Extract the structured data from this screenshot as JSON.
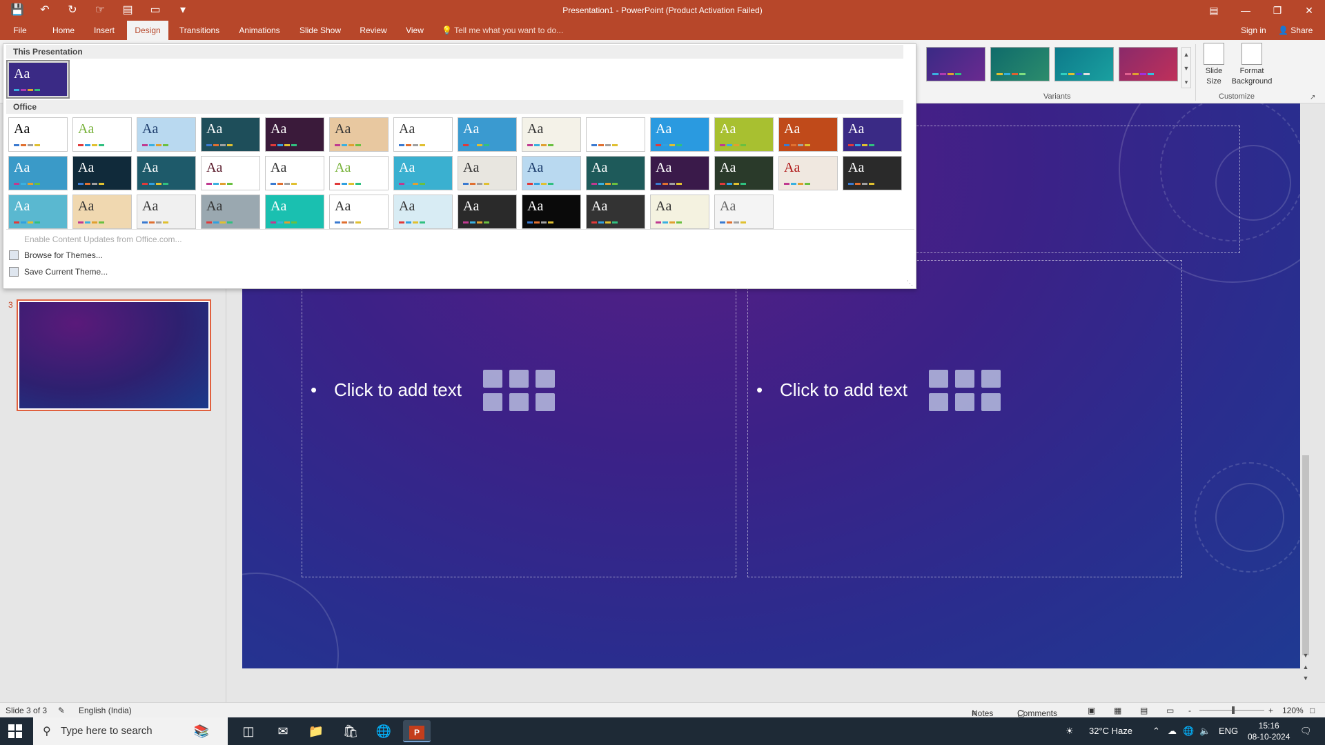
{
  "window": {
    "title": "Presentation1  -  PowerPoint (Product Activation Failed)",
    "qat_icons": [
      "save-icon",
      "undo-icon",
      "redo-icon",
      "touch-mode-icon",
      "layout-icon",
      "start-from-beginning-icon",
      "customize-qat-icon"
    ],
    "controls": [
      "ribbon-display-icon",
      "minimize-icon",
      "restore-icon",
      "close-icon"
    ]
  },
  "tabs": {
    "items": [
      "File",
      "Home",
      "Insert",
      "Design",
      "Transitions",
      "Animations",
      "Slide Show",
      "Review",
      "View"
    ],
    "active": "Design",
    "tell_me": "Tell me what you want to do...",
    "sign_in": "Sign in",
    "share": "Share"
  },
  "ribbon": {
    "variants_label": "Variants",
    "customize_label": "Customize",
    "slide_size": "Slide\nSize",
    "format_background": "Format\nBackground",
    "variants": [
      {
        "bg": "#3a2a85",
        "accent": "#6a2a90"
      },
      {
        "bg": "#0f6b6b",
        "accent": "#2c8c6c"
      },
      {
        "bg": "#0d7a8a",
        "accent": "#1aa0a0"
      },
      {
        "bg": "#8a2a6a",
        "accent": "#c0305a"
      }
    ]
  },
  "gallery": {
    "this_presentation_label": "This Presentation",
    "office_label": "Office",
    "current_theme": {
      "bg": "#3a2a85",
      "fg": "#ffffff"
    },
    "themes": [
      {
        "bg": "#ffffff",
        "fg": "#000000"
      },
      {
        "bg": "#ffffff",
        "fg": "#78b23a"
      },
      {
        "bg": "#b9d9f0",
        "fg": "#1a3a6a"
      },
      {
        "bg": "#1e4e5a",
        "fg": "#ffffff"
      },
      {
        "bg": "#3a1a3a",
        "fg": "#ffffff"
      },
      {
        "bg": "#e8c8a0",
        "fg": "#333333"
      },
      {
        "bg": "#ffffff",
        "fg": "#333333"
      },
      {
        "bg": "#3a9ad0",
        "fg": "#ffffff"
      },
      {
        "bg": "#f4f2e8",
        "fg": "#333333"
      },
      {
        "bg": "#ffffff",
        "fg": "#ffffff"
      },
      {
        "bg": "#2a9ae0",
        "fg": "#ffffff"
      },
      {
        "bg": "#a8c030",
        "fg": "#ffffff"
      },
      {
        "bg": "#c04a1a",
        "fg": "#ffffff"
      },
      {
        "bg": "#3a2a85",
        "fg": "#ffffff"
      },
      {
        "bg": "#3a9ac8",
        "fg": "#ffffff"
      },
      {
        "bg": "#102a3a",
        "fg": "#ffffff"
      },
      {
        "bg": "#1e5a6a",
        "fg": "#ffffff"
      },
      {
        "bg": "#ffffff",
        "fg": "#5a1a2a"
      },
      {
        "bg": "#ffffff",
        "fg": "#333333"
      },
      {
        "bg": "#ffffff",
        "fg": "#78b23a"
      },
      {
        "bg": "#3ab0d0",
        "fg": "#ffffff"
      },
      {
        "bg": "#e8e6e0",
        "fg": "#333333"
      },
      {
        "bg": "#b9d9f0",
        "fg": "#1a3a6a"
      },
      {
        "bg": "#1e5a5a",
        "fg": "#ffffff"
      },
      {
        "bg": "#3a1a4a",
        "fg": "#ffffff"
      },
      {
        "bg": "#2a3a2a",
        "fg": "#ffffff"
      },
      {
        "bg": "#f0e8e0",
        "fg": "#b01a1a"
      },
      {
        "bg": "#2a2a2a",
        "fg": "#ffffff"
      },
      {
        "bg": "#5ab8d0",
        "fg": "#ffffff"
      },
      {
        "bg": "#f0d8b0",
        "fg": "#333333"
      },
      {
        "bg": "#f0f0f0",
        "fg": "#333333"
      },
      {
        "bg": "#9aa8b0",
        "fg": "#333333"
      },
      {
        "bg": "#1ac0b0",
        "fg": "#ffffff"
      },
      {
        "bg": "#ffffff",
        "fg": "#333333"
      },
      {
        "bg": "#d8ecf4",
        "fg": "#333333"
      },
      {
        "bg": "#2a2a2a",
        "fg": "#ffffff"
      },
      {
        "bg": "#0a0a0a",
        "fg": "#ffffff"
      },
      {
        "bg": "#333333",
        "fg": "#ffffff"
      },
      {
        "bg": "#f4f2e0",
        "fg": "#333333"
      },
      {
        "bg": "#f4f4f4",
        "fg": "#666666"
      }
    ],
    "commands": [
      {
        "label": "Enable Content Updates from Office.com...",
        "disabled": true
      },
      {
        "label": "Browse for Themes...",
        "disabled": false
      },
      {
        "label": "Save Current Theme...",
        "disabled": false
      }
    ]
  },
  "thumbnails": {
    "number": "3"
  },
  "slide": {
    "left_placeholder": {
      "bullet": "•",
      "text": "Click to add text"
    },
    "right_placeholder": {
      "bullet": "•",
      "text": "Click to add text"
    },
    "content_icons": [
      "insert-table-icon",
      "insert-chart-icon",
      "insert-smartart-icon",
      "pictures-icon",
      "online-pictures-icon",
      "insert-video-icon"
    ]
  },
  "statusbar": {
    "slide_info": "Slide 3 of 3",
    "language": "English (India)",
    "notes": "Notes",
    "comments": "Comments",
    "zoom_minus": "-",
    "zoom_plus": "+",
    "zoom": "120%"
  },
  "taskbar": {
    "search_placeholder": "Type here to search",
    "weather": "32°C  Haze",
    "language": "ENG",
    "time": "15:16",
    "date": "08-10-2024"
  }
}
